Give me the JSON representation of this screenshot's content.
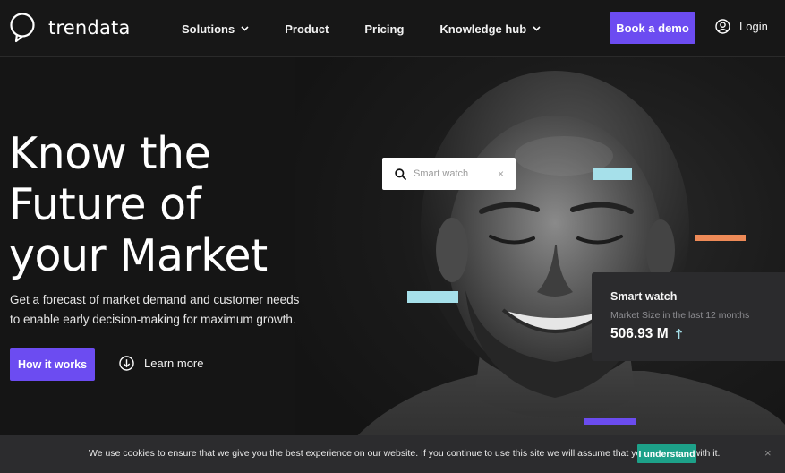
{
  "header": {
    "logo_text": "trendata",
    "nav": [
      {
        "label": "Solutions",
        "has_dropdown": true
      },
      {
        "label": "Product",
        "has_dropdown": false
      },
      {
        "label": "Pricing",
        "has_dropdown": false
      },
      {
        "label": "Knowledge hub",
        "has_dropdown": true
      }
    ],
    "cta_label": "Book a demo",
    "login_label": "Login"
  },
  "hero": {
    "title_lines": [
      "Know the",
      "Future of",
      "your Market"
    ],
    "subtitle_lines": [
      "Get a forecast of market demand and customer needs",
      "to enable early decision-making for maximum growth."
    ],
    "primary_button": "How it works",
    "secondary_link": "Learn more"
  },
  "search_widget": {
    "placeholder": "Smart watch",
    "close_glyph": "×",
    "icon": "search-icon"
  },
  "stat_card": {
    "title": "Smart watch",
    "subtitle": "Market Size in the last 12 months",
    "value": "506.93 M",
    "trend": "up"
  },
  "cookie_banner": {
    "text": "We use cookies to ensure that we give you the best experience on our website. If you continue to use this site we will assume that you are happy with it.",
    "accept_label": "I understand",
    "close_glyph": "×"
  },
  "colors": {
    "accent": "#6c4cf1",
    "background": "#151515",
    "cookie_button": "#1da189",
    "light_blue_bar": "#a6e0ea",
    "orange_bar": "#ee8a57",
    "card_bg": "#2b2b2d"
  }
}
